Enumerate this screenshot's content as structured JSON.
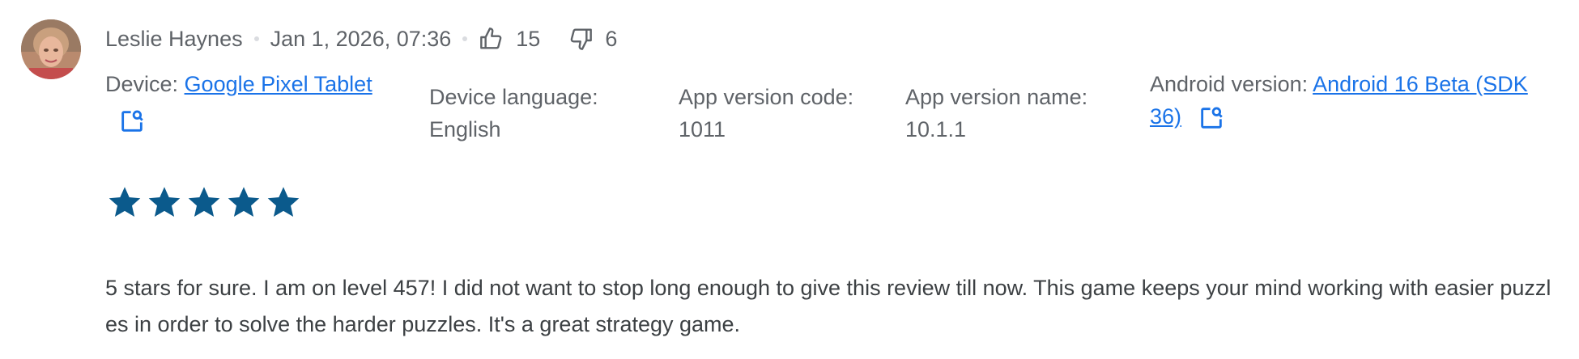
{
  "review": {
    "author": "Leslie Haynes",
    "date": "Jan 1, 2026, 07:36",
    "thumbs_up_count": "15",
    "thumbs_down_count": "6",
    "rating": 5,
    "rating_max": 5,
    "text": "5 stars for sure. I am on level 457! I did not want to stop long enough to give this review till now. This game keeps your mind working with easier puzzles in order to solve the harder puzzles. It's a great strategy game."
  },
  "meta": {
    "device_label": "Device:",
    "device_value": "Google Pixel Tablet",
    "language_label": "Device language:",
    "language_value": "English",
    "version_code_label": "App version code:",
    "version_code_value": "1011",
    "version_name_label": "App version name:",
    "version_name_value": "10.1.1",
    "android_label": "Android version:",
    "android_value": "Android 16 Beta (SDK 36)"
  },
  "colors": {
    "star": "#0b5a8c",
    "link": "#1a73e8",
    "icon": "#1a73e8",
    "thumb_icon": "#5f6368"
  },
  "icons": {
    "thumbs_up": "thumbs-up-icon",
    "thumbs_down": "thumbs-down-icon",
    "copy": "copy-search-icon",
    "star": "star-icon"
  }
}
